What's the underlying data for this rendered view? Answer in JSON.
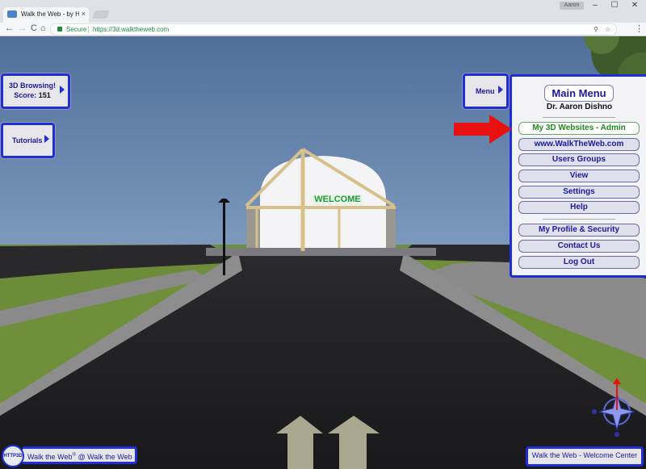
{
  "browser": {
    "tab_title": "Walk the Web - by HTTP",
    "tab_close": "×",
    "user_chip": "Aaron",
    "window_minimize": "–",
    "window_maximize": "☐",
    "window_close": "✕",
    "nav_back": "←",
    "nav_forward": "→",
    "nav_reload": "C",
    "nav_home": "⌂",
    "secure_label": "Secure",
    "url": "https://3d.walktheweb.com",
    "menu_glyph": "⋮"
  },
  "hud": {
    "score_title": "3D Browsing!",
    "score_label": "Score:",
    "score_value": "151",
    "tutorials": "Tutorials",
    "menu_button": "Menu",
    "walk_text": "Walk the Web",
    "walk_reg": "®",
    "walk_suffix": " @ Walk the Web",
    "logo_text": "HTTP3D",
    "location": "Walk the Web - Welcome Center"
  },
  "main_menu": {
    "title": "Main Menu",
    "user_name": "Dr. Aaron Dishno",
    "items": [
      {
        "label": "My 3D Websites - Admin"
      },
      {
        "label": "www.WalkTheWeb.com"
      },
      {
        "label": "Users Groups"
      },
      {
        "label": "View"
      },
      {
        "label": "Settings"
      },
      {
        "label": "Help"
      },
      {
        "label": "My Profile & Security"
      },
      {
        "label": "Contact Us"
      },
      {
        "label": "Log Out"
      }
    ]
  },
  "scene": {
    "sign_text": "WELCOME",
    "colors": {
      "sky": "#5d7da6",
      "grass": "#6f8f3a",
      "road": "#202022",
      "hud_border": "#1e2ed8",
      "highlight_arrow": "#e81010"
    }
  }
}
